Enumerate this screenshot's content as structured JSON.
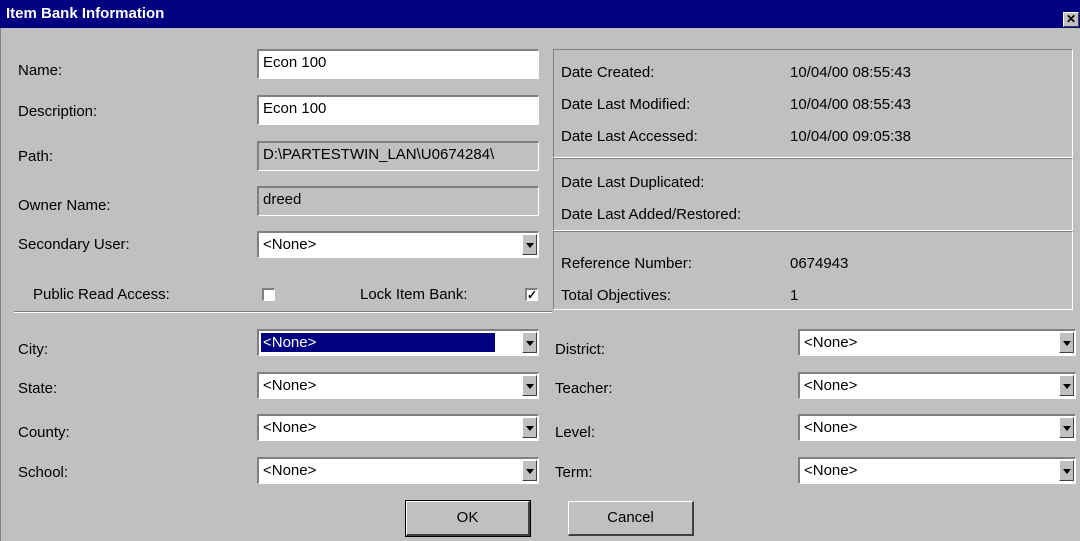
{
  "window": {
    "title": "Item Bank Information",
    "close_glyph": "✕"
  },
  "form": {
    "name_label": "Name:",
    "name_value": "Econ 100",
    "description_label": "Description:",
    "description_value": "Econ 100",
    "path_label": "Path:",
    "path_value": "D:\\PARTESTWIN_LAN\\U0674284\\",
    "owner_label": "Owner Name:",
    "owner_value": "dreed",
    "secondary_user_label": "Secondary User:",
    "secondary_user_value": "<None>",
    "public_read_label": "Public Read Access:",
    "public_read_checked": false,
    "lock_label": "Lock Item Bank:",
    "lock_checked": true,
    "lock_mark": "✓"
  },
  "info": {
    "date_created_label": "Date Created:",
    "date_created_value": "10/04/00 08:55:43",
    "date_modified_label": "Date Last Modified:",
    "date_modified_value": "10/04/00 08:55:43",
    "date_accessed_label": "Date Last Accessed:",
    "date_accessed_value": "10/04/00 09:05:38",
    "date_duplicated_label": "Date Last Duplicated:",
    "date_restored_label": "Date Last Added/Restored:",
    "reference_label": "Reference Number:",
    "reference_value": "0674943",
    "objectives_label": "Total Objectives:",
    "objectives_value": "1"
  },
  "fields": {
    "city_label": "City:",
    "city_value": "<None>",
    "state_label": "State:",
    "state_value": "<None>",
    "county_label": "County:",
    "county_value": "<None>",
    "school_label": "School:",
    "school_value": "<None>",
    "district_label": "District:",
    "district_value": "<None>",
    "teacher_label": "Teacher:",
    "teacher_value": "<None>",
    "level_label": "Level:",
    "level_value": "<None>",
    "term_label": "Term:",
    "term_value": "<None>"
  },
  "buttons": {
    "ok": "OK",
    "cancel": "Cancel"
  }
}
